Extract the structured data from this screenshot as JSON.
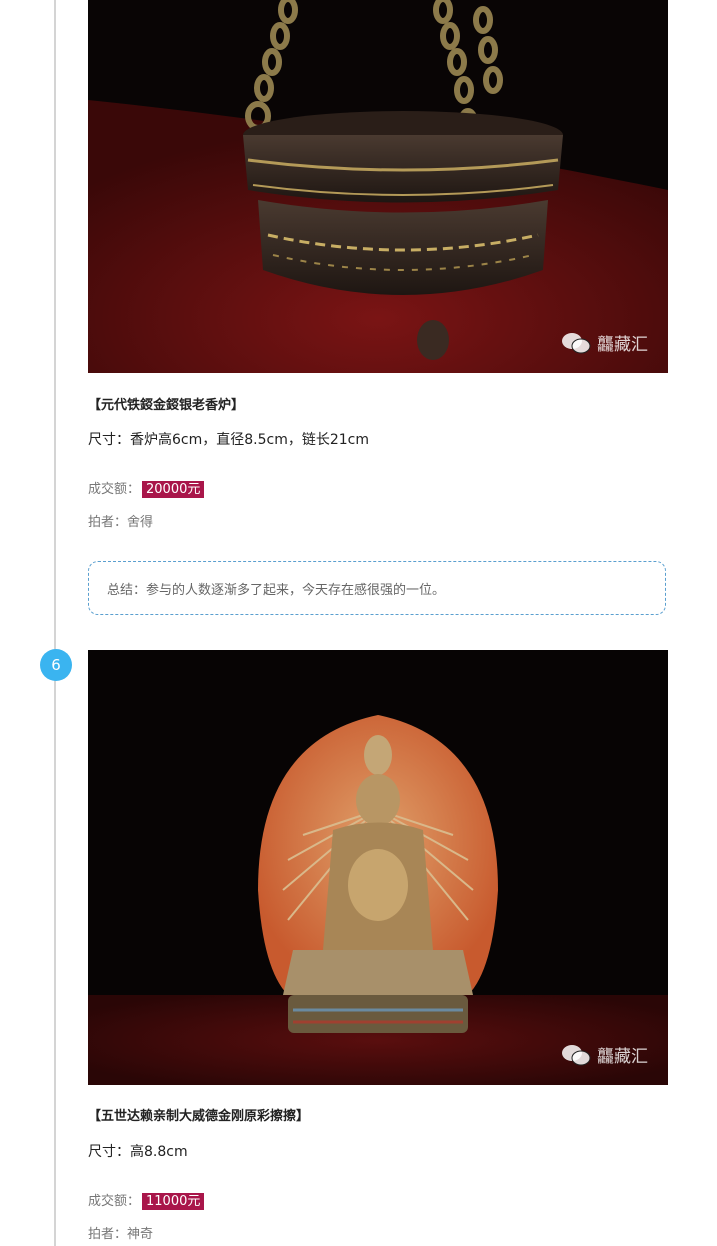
{
  "timeline": {
    "step_number": "6"
  },
  "watermark": {
    "text": "龘藏汇",
    "icon": "wechat-icon"
  },
  "items": [
    {
      "title": "【元代铁鋄金鋄银老香炉】",
      "size": "尺寸：香炉高6cm，直径8.5cm，链长21cm",
      "price_label": "成交额：",
      "price": "20000元",
      "buyer_label": "拍者：",
      "buyer": "舍得"
    },
    {
      "title": "【五世达赖亲制大威德金刚原彩擦擦】",
      "size": "尺寸：高8.8cm",
      "price_label": "成交额：",
      "price": "11000元",
      "buyer_label": "拍者：",
      "buyer": "神奇"
    }
  ],
  "summary": {
    "text": "总结：参与的人数逐渐多了起来，今天存在感很强的一位。"
  },
  "colors": {
    "accent_blue": "#3ab4f0",
    "price_bg": "#a9164a",
    "dashed_border": "#5a9fcf"
  }
}
